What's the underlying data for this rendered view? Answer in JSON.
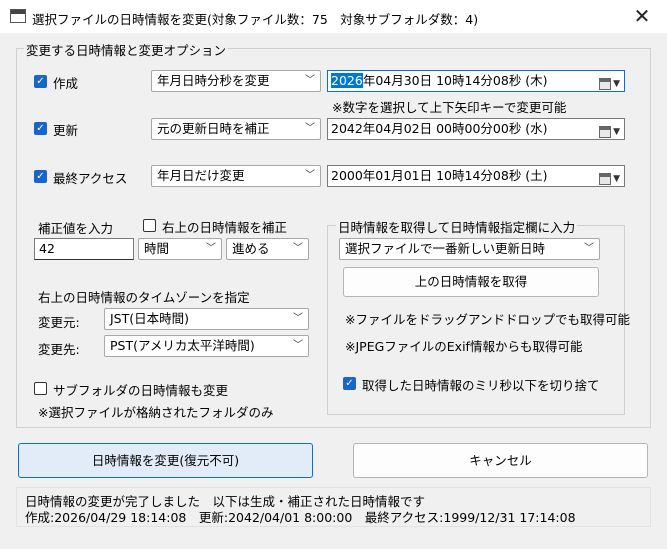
{
  "window": {
    "title": "選択ファイルの日時情報を変更(対象ファイル数：75　対象サブフォルダ数：4)",
    "close_glyph": "✕"
  },
  "options_group": {
    "title": "変更する日時情報と変更オプション",
    "rows": [
      {
        "label": "作成",
        "checked": true,
        "mode": "年月日時分秒を変更",
        "datetime_selected": "2026",
        "datetime_rest": "年04月30日 10時14分08秒 (木)"
      },
      {
        "label": "更新",
        "checked": true,
        "mode": "元の更新日時を補正",
        "datetime": "2042年04月02日 00時00分00秒 (水)"
      },
      {
        "label": "最終アクセス",
        "checked": true,
        "mode": "年月日だけ変更",
        "datetime": "2000年01月01日 10時14分08秒 (土)"
      }
    ],
    "hint": "※数字を選択して上下矢印キーで変更可能"
  },
  "correction": {
    "label": "補正値を入力",
    "value": "42",
    "unit": "時間",
    "direction": "進める",
    "use_topright_label": "右上の日時情報を補正",
    "use_topright_checked": false
  },
  "timezone": {
    "title": "右上の日時情報のタイムゾーンを指定",
    "from_label": "変更元:",
    "from_value": "JST(日本時間)",
    "to_label": "変更先:",
    "to_value": "PST(アメリカ太平洋時間)"
  },
  "subfolder": {
    "label": "サブフォルダの日時情報も変更",
    "checked": false,
    "note": "※選択ファイルが格納されたフォルダのみ"
  },
  "fetch_group": {
    "title": "日時情報を取得して日時情報指定欄に入力",
    "source": "選択ファイルで一番新しい更新日時",
    "fetch_button": "上の日時情報を取得",
    "note1": "※ファイルをドラッグアンドドロップでも取得可能",
    "note2": "※JPEGファイルのExif情報からも取得可能",
    "truncate_label": "取得した日時情報のミリ秒以下を切り捨て",
    "truncate_checked": true
  },
  "actions": {
    "apply": "日時情報を変更(復元不可)",
    "cancel": "キャンセル"
  },
  "status": {
    "line1": "日時情報の変更が完了しました　以下は生成・補正された日時情報です",
    "line2": "作成:2026/04/29 18:14:08　更新:2042/04/01 8:00:00　最終アクセス:1999/12/31 17:14:08"
  },
  "icons": {
    "check": "✓",
    "dropdown": "﹀",
    "app": "window-app-icon",
    "calendar": "calendar-icon"
  },
  "colors": {
    "accent": "#0078d7",
    "checkbox": "#1a65c8",
    "window_bg": "#f0f0f0"
  }
}
